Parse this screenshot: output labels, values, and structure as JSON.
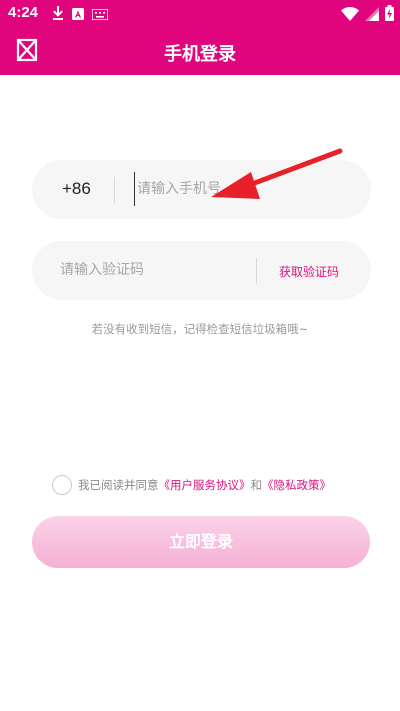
{
  "statusbar": {
    "time": "4:24",
    "icons": [
      "download-icon",
      "notification-a-icon",
      "keyboard-icon",
      "wifi-icon",
      "signal-icon",
      "battery-charging-icon"
    ]
  },
  "header": {
    "title": "手机登录",
    "close_icon": "close-box-icon"
  },
  "form": {
    "country_code": "+86",
    "phone_placeholder": "请输入手机号",
    "phone_value": "",
    "code_placeholder": "请输入验证码",
    "code_value": "",
    "get_code_label": "获取验证码",
    "hint": "若没有收到短信，记得检查短信垃圾箱哦~"
  },
  "agreement": {
    "checked": false,
    "prefix": "我已阅读并同意",
    "user_agreement": "《用户服务协议》",
    "and": "和",
    "privacy_policy": "《隐私政策》"
  },
  "login_button_label": "立即登录",
  "colors": {
    "brand": "#e0057d",
    "link": "#d8147d",
    "field_bg": "#f6f6f6",
    "button_gradient_top": "#fbd3e8",
    "button_gradient_bottom": "#f5b0d4",
    "annotation_arrow": "#e8202a"
  }
}
